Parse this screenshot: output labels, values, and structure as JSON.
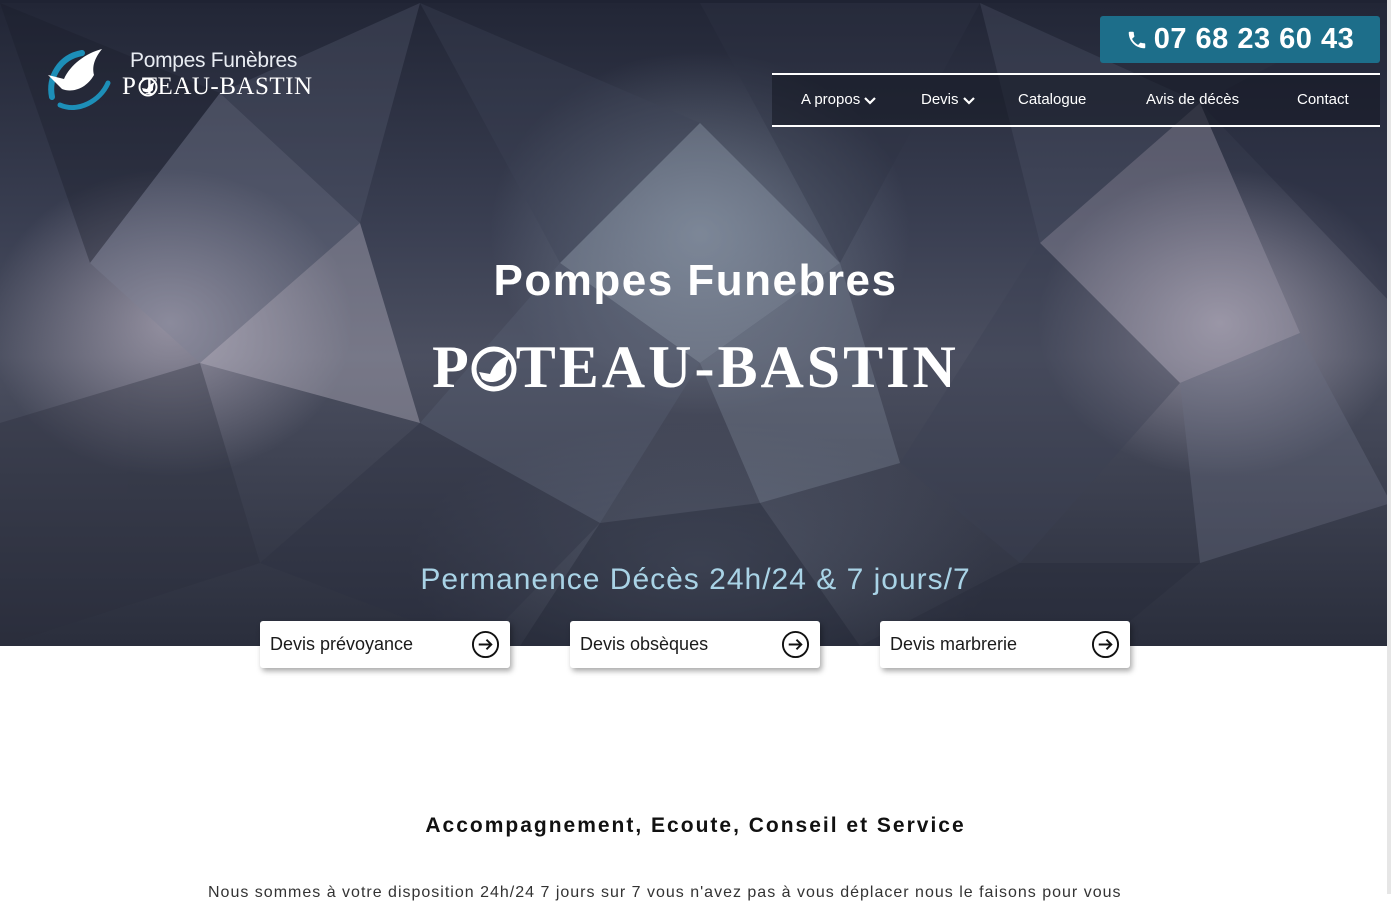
{
  "logo": {
    "line1": "Pompes Funèbres",
    "line2": "P   TEAU-BASTIN"
  },
  "header": {
    "phone": "07 68 23 60 43"
  },
  "nav": {
    "items": [
      {
        "label": "A propos",
        "dropdown": true
      },
      {
        "label": "Devis",
        "dropdown": true
      },
      {
        "label": "Catalogue",
        "dropdown": false
      },
      {
        "label": "Avis de décès",
        "dropdown": false
      },
      {
        "label": "Contact",
        "dropdown": false
      }
    ]
  },
  "hero": {
    "title": "Pompes Funebres",
    "name_start": "P",
    "name_end": "TEAU-BASTIN",
    "permanence": "Permanence Décès 24h/24 & 7 jours/7"
  },
  "quotes": [
    {
      "label": "Devis prévoyance"
    },
    {
      "label": "Devis obsèques"
    },
    {
      "label": "Devis marbrerie"
    }
  ],
  "section": {
    "title": "Accompagnement, Ecoute, Conseil et Service",
    "intro": "Nous sommes à votre disposition 24h/24 7 jours sur 7 vous n'avez pas à vous déplacer nous le faisons pour vous"
  },
  "colors": {
    "phone_bg": "#1d6e8a",
    "permanence": "#a9d3e6",
    "hero_dark": "#222636"
  },
  "icons": {
    "phone": "phone-icon",
    "chevron": "chevron-down-icon",
    "arrow": "arrow-right-circle-icon",
    "dove": "dove-icon"
  }
}
